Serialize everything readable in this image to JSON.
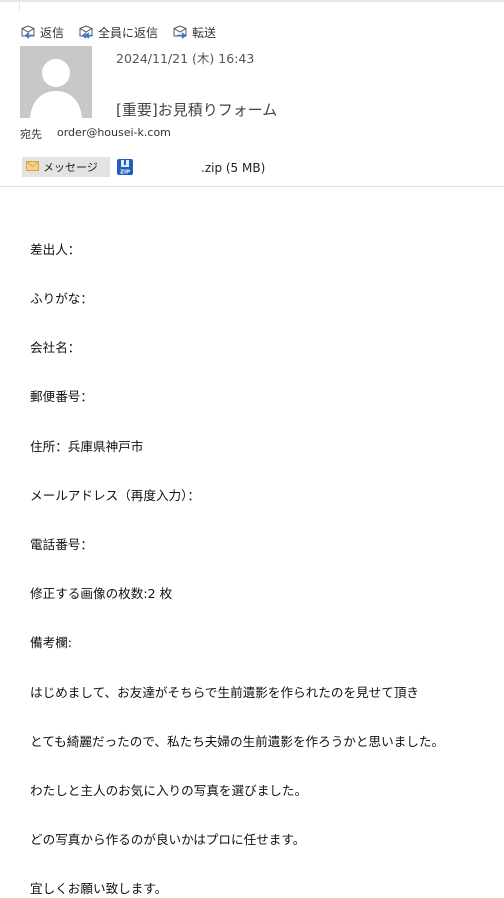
{
  "toolbar": {
    "reply_label": "返信",
    "reply_all_label": "全員に返信",
    "forward_label": "転送"
  },
  "header": {
    "date": "2024/11/21 (木) 16:43",
    "subject": "[重要]お見積りフォーム",
    "to_label": "宛先",
    "to_value": "order@housei-k.com"
  },
  "attachments": {
    "message_label": "メッセージ",
    "zip_icon_label": "ZIP",
    "zip_name": ".zip (5 MB)"
  },
  "body": {
    "lines": [
      "差出人：",
      "ふりがな：",
      "会社名：",
      "郵便番号：",
      "住所：兵庫県神戸市",
      "メールアドレス（再度入力）：",
      "電話番号：",
      "修正する画像の枚数:2 枚",
      "備考欄:",
      "はじめまして、お友達がそちらで生前遺影を作られたのを見せて頂き",
      "とても綺麗だったので、私たち夫婦の生前遺影を作ろうかと思いました。",
      "わたしと主人のお気に入りの写真を選びました。",
      "どの写真から作るのが良いかはプロに任せます。",
      "宜しくお願い致します。"
    ]
  },
  "colors": {
    "reply_icon": "#3a6fc4",
    "avatar_bg": "#c8c8c8",
    "avatar_fg": "#ffffff",
    "message_chip_bg": "#e3e3e3",
    "mail_icon": "#d8a640",
    "zip_icon": "#1f5fbf"
  }
}
